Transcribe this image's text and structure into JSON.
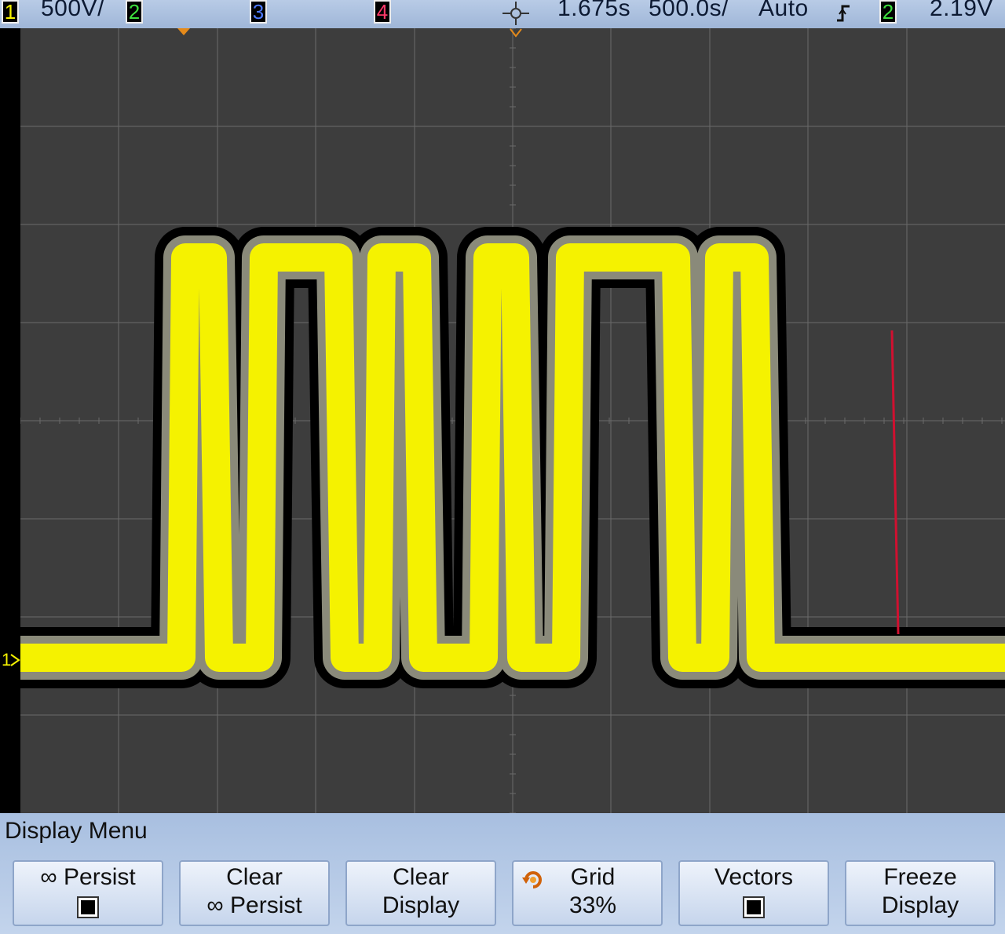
{
  "status_bar": {
    "ch1_number": "1",
    "ch1_scale": "500V/",
    "ch2_number": "2",
    "ch3_number": "3",
    "ch4_number": "4",
    "delay_icon": "trigger-point-icon",
    "time_delay": "1.675s",
    "time_scale": "500.0s/",
    "trigger_mode": "Auto",
    "trigger_slope_icon": "rising-edge-icon",
    "trigger_channel": "2",
    "trigger_level": "2.19V"
  },
  "screen": {
    "ground_marker": "1",
    "colors": {
      "background": "#3d3d3d",
      "grid": "#6a6a6a",
      "trace": "#f5f200",
      "halo": "#000000",
      "marker": "#d01030"
    }
  },
  "menu": {
    "title": "Display Menu",
    "softkeys": [
      {
        "line1": "∞ Persist",
        "line2": "",
        "control": "checkbox",
        "checked": true
      },
      {
        "line1": "Clear",
        "line2": "∞ Persist"
      },
      {
        "line1": "Clear",
        "line2": "Display"
      },
      {
        "line1": "Grid",
        "line2": "33%",
        "icon": "rotate-knob-icon"
      },
      {
        "line1": "Vectors",
        "line2": "",
        "control": "checkbox",
        "checked": true
      },
      {
        "line1": "Freeze",
        "line2": "Display"
      }
    ]
  }
}
